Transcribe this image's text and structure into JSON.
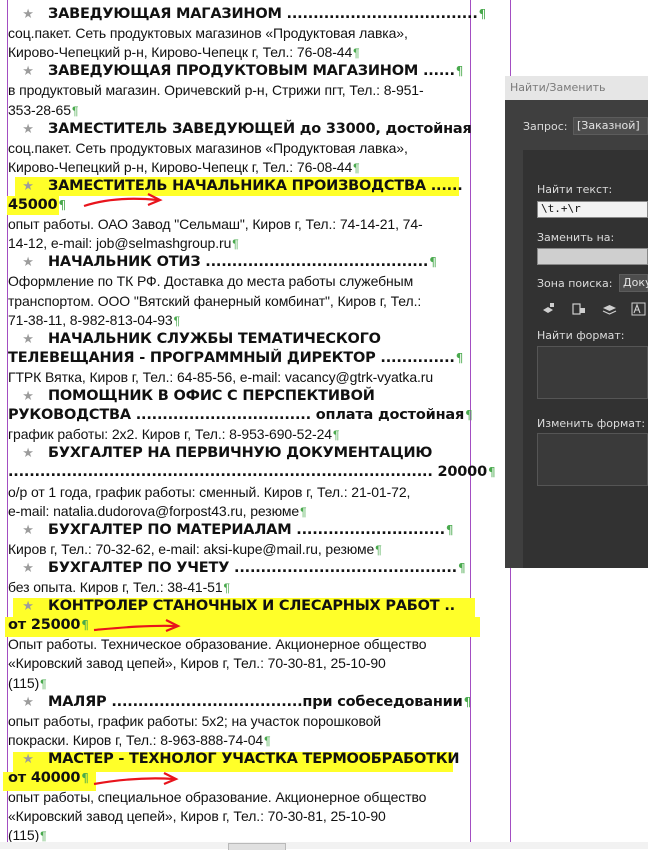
{
  "document": {
    "lines": [
      {
        "kind": "title",
        "star": true,
        "text": "ЗАВЕДУЮЩАЯ МАГАЗИНОМ ....................................",
        "pilcrow": true
      },
      {
        "kind": "body",
        "text": "соц.пакет. Сеть продуктовых магазинов «Продуктовая лавка»,",
        "pilcrow": false
      },
      {
        "kind": "body",
        "text": "Кирово-Чепецкий р-н, Кирово-Чепецк г, Тел.: 76-08-44",
        "pilcrow": true
      },
      {
        "kind": "title",
        "star": true,
        "text": "ЗАВЕДУЮЩАЯ ПРОДУКТОВЫМ МАГАЗИНОМ ......",
        "pilcrow": true
      },
      {
        "kind": "body",
        "text": "в продуктовый магазин. Оричевский р-н, Стрижи пгт, Тел.: 8-951-",
        "pilcrow": false
      },
      {
        "kind": "body",
        "text": "353-28-65",
        "pilcrow": true
      },
      {
        "kind": "title",
        "star": true,
        "text": "ЗАМЕСТИТЕЛЬ ЗАВЕДУЮЩЕЙ до 33000, достойная",
        "pilcrow": false
      },
      {
        "kind": "body",
        "text": "соц.пакет. Сеть продуктовых магазинов «Продуктовая лавка»,",
        "pilcrow": false
      },
      {
        "kind": "body",
        "text": "Кирово-Чепецкий р-н, Кирово-Чепецк г, Тел.: 76-08-44",
        "pilcrow": true
      },
      {
        "kind": "title",
        "star": true,
        "text": "ЗАМЕСТИТЕЛЬ НАЧАЛЬНИКА ПРОИЗВОДСТВА ......",
        "pilcrow": false
      },
      {
        "kind": "title",
        "star": false,
        "text": "45000",
        "pilcrow": true
      },
      {
        "kind": "body",
        "text": "опыт работы. ОАО Завод \"Сельмаш\", Киров г, Тел.: 74-14-21, 74-",
        "pilcrow": false
      },
      {
        "kind": "body",
        "text": "14-12, e-mail: job@selmashgroup.ru",
        "pilcrow": true
      },
      {
        "kind": "title",
        "star": true,
        "text": "НАЧАЛЬНИК ОТИЗ ..........................................",
        "pilcrow": true
      },
      {
        "kind": "body",
        "text": "Оформление по ТК РФ. Доставка до места работы служебным",
        "pilcrow": false
      },
      {
        "kind": "body",
        "text": "транспортом. ООО \"Вятский фанерный комбинат\", Киров г, Тел.:",
        "pilcrow": false
      },
      {
        "kind": "body",
        "text": "71-38-11, 8-982-813-04-93",
        "pilcrow": true
      },
      {
        "kind": "title",
        "star": true,
        "text": "НАЧАЛЬНИК   СЛУЖБЫ   ТЕМАТИЧЕСКОГО",
        "pilcrow": false
      },
      {
        "kind": "title",
        "star": false,
        "text": "ТЕЛЕВЕЩАНИЯ - ПРОГРАММНЫЙ ДИРЕКТОР ..............",
        "pilcrow": true
      },
      {
        "kind": "body",
        "text": "ГТРК Вятка, Киров г, Тел.: 64-85-56, e-mail: vacancy@gtrk-vyatka.ru",
        "pilcrow": false
      },
      {
        "kind": "title",
        "star": true,
        "text": "ПОМОЩНИК  В  ОФИС  С  ПЕРСПЕКТИВОЙ",
        "pilcrow": false
      },
      {
        "kind": "title",
        "star": false,
        "text": "РУКОВОДСТВА ................................. оплата достойная",
        "pilcrow": true
      },
      {
        "kind": "body",
        "text": "график работы: 2х2. Киров г, Тел.: 8-953-690-52-24",
        "pilcrow": true
      },
      {
        "kind": "title",
        "star": true,
        "text": "БУХГАЛТЕР НА ПЕРВИЧНУЮ ДОКУМЕНТАЦИЮ",
        "pilcrow": false
      },
      {
        "kind": "title",
        "star": false,
        "text": "................................................................................ 20000",
        "pilcrow": true
      },
      {
        "kind": "body",
        "text": "о/р от 1 года, график работы: сменный. Киров г, Тел.: 21-01-72,",
        "pilcrow": false
      },
      {
        "kind": "body",
        "text": "e-mail: natalia.dudorova@forpost43.ru, резюме",
        "pilcrow": true
      },
      {
        "kind": "title",
        "star": true,
        "text": "БУХГАЛТЕР ПО МАТЕРИАЛАМ ............................",
        "pilcrow": true
      },
      {
        "kind": "body",
        "text": "Киров г, Тел.: 70-32-62, e-mail: aksi-kupe@mail.ru, резюме",
        "pilcrow": true
      },
      {
        "kind": "title",
        "star": true,
        "text": "БУХГАЛТЕР ПО УЧЕТУ ..........................................",
        "pilcrow": true
      },
      {
        "kind": "body",
        "text": "без опыта. Киров г, Тел.: 38-41-51",
        "pilcrow": true
      },
      {
        "kind": "title",
        "star": true,
        "text": "КОНТРОЛЕР СТАНОЧНЫХ И СЛЕСАРНЫХ РАБОТ ..",
        "pilcrow": false
      },
      {
        "kind": "title",
        "star": false,
        "text": "от 25000",
        "pilcrow": true
      },
      {
        "kind": "body",
        "text": "Опыт работы. Техническое образование. Акционерное общество",
        "pilcrow": false
      },
      {
        "kind": "body",
        "text": "«Кировский завод цепей», Киров г, Тел.: 70-30-81, 25-10-90",
        "pilcrow": false
      },
      {
        "kind": "body",
        "text": "(115)",
        "pilcrow": true
      },
      {
        "kind": "title",
        "star": true,
        "text": "МАЛЯР  ....................................при собеседовании",
        "pilcrow": true
      },
      {
        "kind": "body",
        "text": "опыт работы, график работы: 5х2; на участок порошковой",
        "pilcrow": false
      },
      {
        "kind": "body",
        "text": "покраски. Киров г, Тел.: 8-963-888-74-04",
        "pilcrow": true
      },
      {
        "kind": "title",
        "star": true,
        "text": "МАСТЕР - ТЕХНОЛОГ УЧАСТКА ТЕРМООБРАБОТКИ",
        "pilcrow": false
      },
      {
        "kind": "title",
        "star": false,
        "text": "от 40000",
        "pilcrow": true
      },
      {
        "kind": "body",
        "text": "опыт работы, специальное образование. Акционерное общество",
        "pilcrow": false
      },
      {
        "kind": "body",
        "text": "«Кировский завод цепей», Киров г, Тел.: 70-30-81, 25-10-90",
        "pilcrow": false
      },
      {
        "kind": "body",
        "text": "(115)",
        "pilcrow": true
      }
    ],
    "pilcrow_glyph": "¶",
    "star_glyph": "★",
    "highlight_color": "#ffff29",
    "arrow_color": "#e8141c"
  },
  "dialog": {
    "title": "Найти/Заменить",
    "query_label": "Запрос:",
    "query_value": "[Заказной]",
    "find_label": "Найти текст:",
    "find_value": "\\t.+\\r",
    "replace_label": "Заменить на:",
    "replace_value": "",
    "search_zone_label": "Зона поиска:",
    "search_zone_value": "Доку",
    "find_format_label": "Найти формат:",
    "change_format_label": "Изменить формат:",
    "icons": [
      "lock-layers-icon",
      "lock-stories-icon",
      "hidden-layers-icon",
      "case-sensitive-icon"
    ]
  }
}
